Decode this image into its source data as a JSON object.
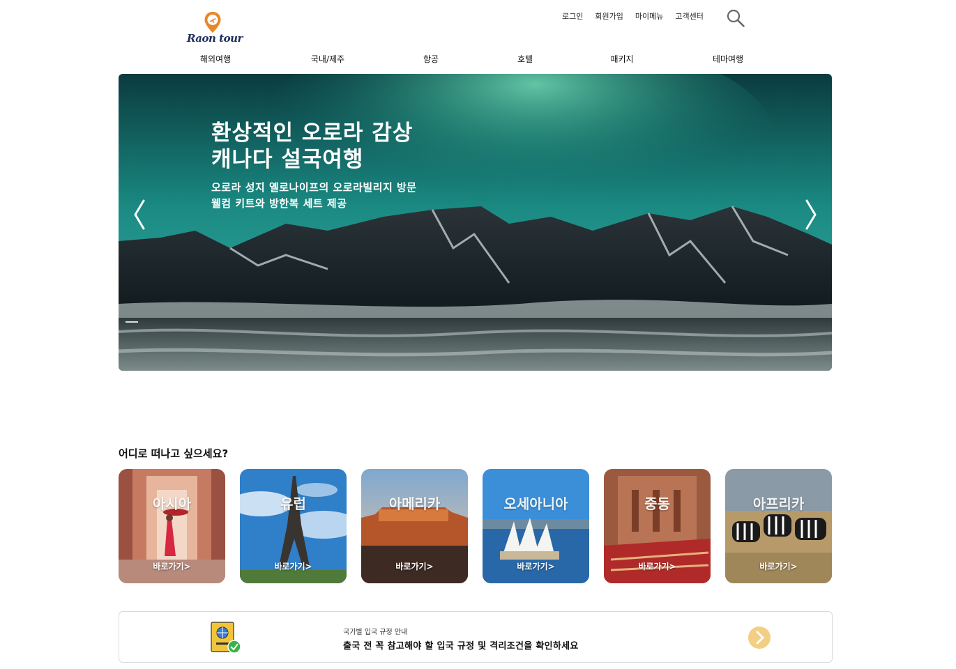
{
  "header": {
    "logo_text": "Raon tour",
    "util_links": [
      "로그인",
      "회원가입",
      "마이메뉴",
      "고객센터"
    ],
    "search_icon": "search-icon",
    "nav": [
      "해외여행",
      "국내/제주",
      "항공",
      "호텔",
      "패키지",
      "테마여행"
    ]
  },
  "hero": {
    "title_line1": "환상적인 오로라 감상",
    "title_line2": "캐나다 설국여행",
    "sub_line1": "오로라 성지 옐로나이프의 오로라빌리지 방문",
    "sub_line2": "웰컴 키트와 방한복 세트 제공",
    "prev_icon": "chevron-left-icon",
    "next_icon": "chevron-right-icon"
  },
  "destinations": {
    "title": "어디로 떠나고 싶으세요?",
    "cards": [
      {
        "name": "아시아",
        "link": "바로가기>"
      },
      {
        "name": "유럽",
        "link": "바로가기>"
      },
      {
        "name": "아메리카",
        "link": "바로가기>"
      },
      {
        "name": "오세아니아",
        "link": "바로가기>"
      },
      {
        "name": "중동",
        "link": "바로가기>"
      },
      {
        "name": "아프리카",
        "link": "바로가기>"
      }
    ]
  },
  "notice": {
    "small": "국가별 입국 규정 안내",
    "main": "출국 전 꼭 참고해야 할 입국 규정 및 격리조건을 확인하세요",
    "icon": "passport-icon",
    "go_icon": "chevron-right-circle-icon"
  },
  "colors": {
    "accent": "#f2cf83",
    "logo_pin": "#e8862a",
    "logo_text": "#1d2d5c",
    "card_border": "#d9d9d9"
  }
}
